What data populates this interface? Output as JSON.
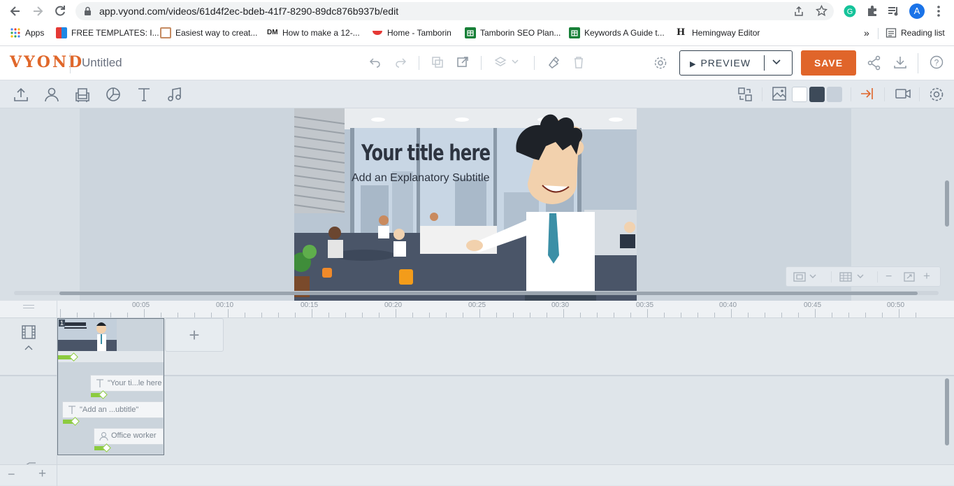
{
  "browser": {
    "url": "app.vyond.com/videos/61d4f2ec-bdeb-41f7-8290-89dc876b937b/edit",
    "profile_initial": "A",
    "bookmarks": [
      {
        "label": "Apps"
      },
      {
        "label": "FREE TEMPLATES: I..."
      },
      {
        "label": "Easiest way to creat..."
      },
      {
        "label": "How to make a 12-..."
      },
      {
        "label": "Home - Tamborin"
      },
      {
        "label": "Tamborin SEO Plan..."
      },
      {
        "label": "Keywords A Guide t..."
      },
      {
        "label": "Hemingway Editor"
      }
    ],
    "more_label": "»",
    "reading_list": "Reading list"
  },
  "app": {
    "logo": "VYOND",
    "title": "Untitled",
    "preview_label": "PREVIEW",
    "save_label": "SAVE",
    "accent": "#e0652a"
  },
  "stage": {
    "title": "Your title here",
    "subtitle": "Add an Explanatory Subtitle"
  },
  "ruler": {
    "labels": [
      "00:05",
      "00:10",
      "00:15",
      "00:20",
      "00:25",
      "00:30",
      "00:35",
      "00:40",
      "00:45",
      "00:50"
    ]
  },
  "timeline": {
    "scene_number": "1",
    "add_label": "+",
    "items": [
      {
        "label": "\"Your ti...le here"
      },
      {
        "label": "\"Add an ...ubtitle\""
      },
      {
        "label": "Office worker"
      }
    ],
    "zoom_out": "−",
    "zoom_in": "+"
  }
}
